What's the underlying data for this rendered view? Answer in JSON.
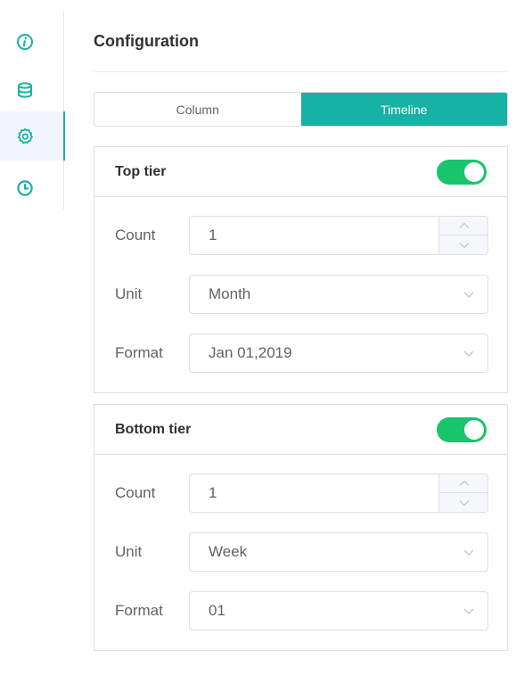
{
  "sidebar": {
    "items": [
      {
        "icon": "info-icon",
        "active": false
      },
      {
        "icon": "database-icon",
        "active": false
      },
      {
        "icon": "settings-gear-icon",
        "active": true
      },
      {
        "icon": "clock-icon",
        "active": false
      }
    ]
  },
  "main": {
    "title": "Configuration",
    "tabs": [
      {
        "label": "Column",
        "active": false
      },
      {
        "label": "Timeline",
        "active": true
      }
    ],
    "top_tier": {
      "title": "Top tier",
      "enabled": true,
      "count_label": "Count",
      "count_value": "1",
      "unit_label": "Unit",
      "unit_value": "Month",
      "format_label": "Format",
      "format_value": "Jan 01,2019"
    },
    "bottom_tier": {
      "title": "Bottom tier",
      "enabled": true,
      "count_label": "Count",
      "count_value": "1",
      "unit_label": "Unit",
      "unit_value": "Week",
      "format_label": "Format",
      "format_value": "01"
    }
  },
  "colors": {
    "accent": "#16b2a3",
    "switch_on": "#19c46a",
    "border": "#dcdfe6",
    "text": "#606266"
  }
}
